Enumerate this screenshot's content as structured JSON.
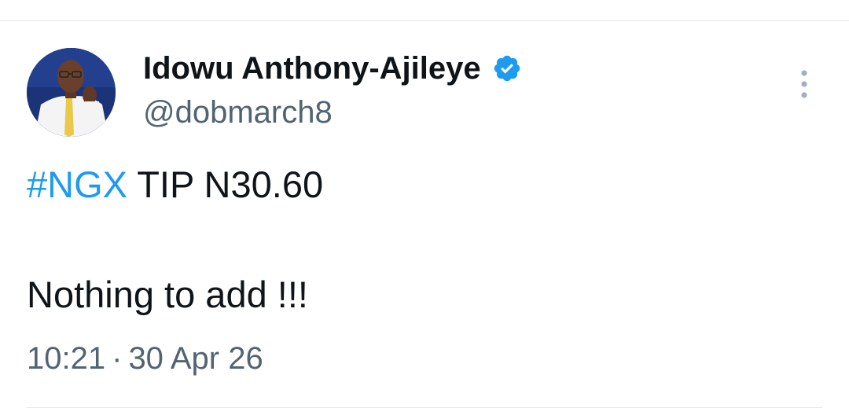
{
  "author": {
    "name": "Idowu Anthony-Ajileye",
    "handle": "@dobmarch8",
    "verified": true
  },
  "tweet": {
    "hashtag": "#NGX",
    "line1_rest": " TIP N30.60",
    "line2": "Nothing to add !!!"
  },
  "meta": {
    "time": "10:21",
    "separator": "·",
    "date": "30 Apr 26"
  },
  "icons": {
    "verified": "verified-badge-icon",
    "more": "more-options-icon"
  },
  "colors": {
    "text": "#0f1419",
    "muted": "#536471",
    "accent": "#1d9bf0"
  }
}
